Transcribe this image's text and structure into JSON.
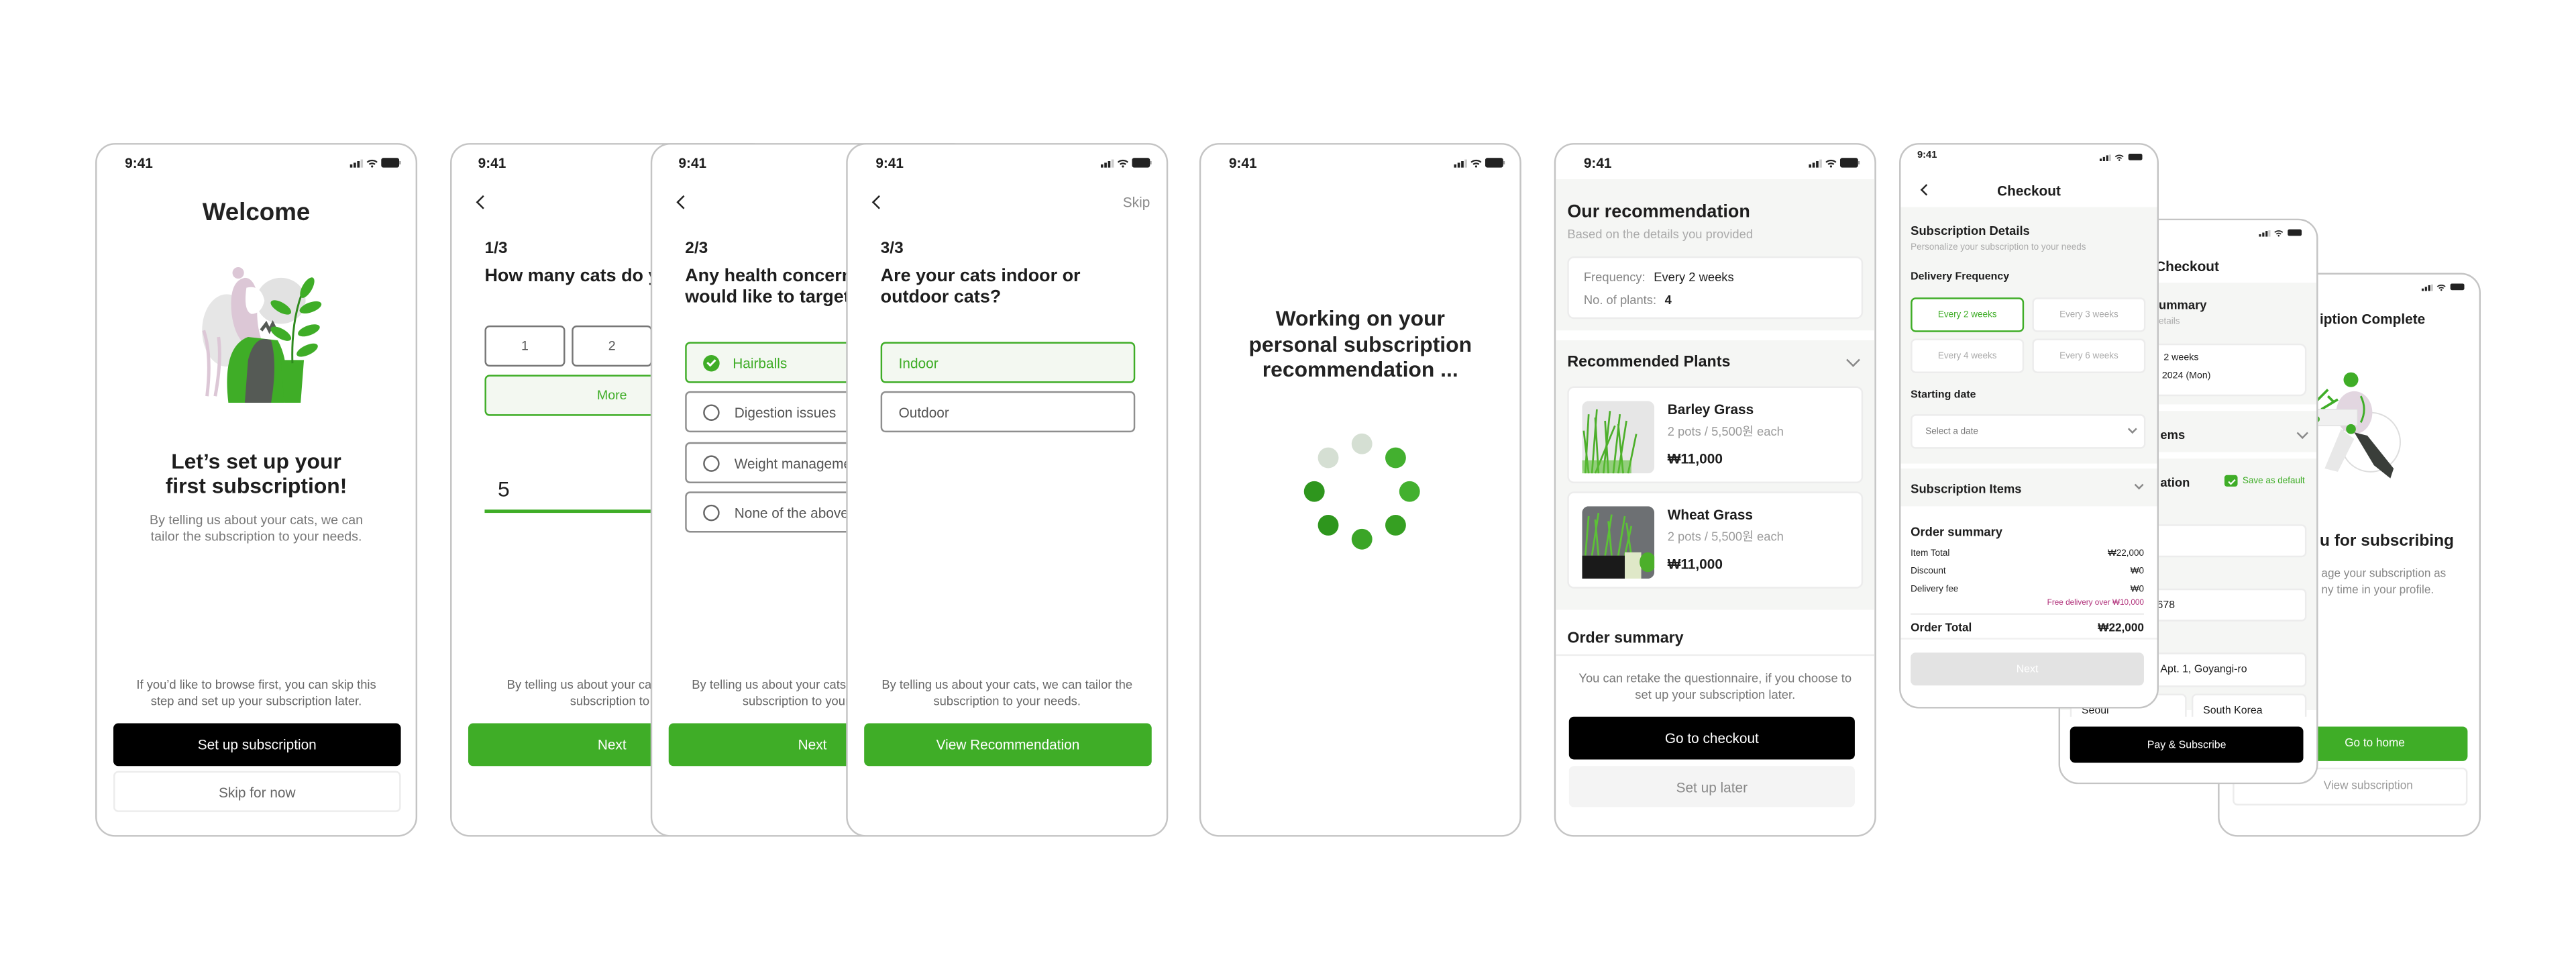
{
  "status_time": "9:41",
  "colors": {
    "accent": "#3fad27",
    "dark": "#000000",
    "promo": "#b0307a",
    "panel": "#f5f6f4"
  },
  "icons": [
    "signal-icon",
    "wifi-icon",
    "battery-icon",
    "chevron-left-icon",
    "chevron-down-icon",
    "check-circle-icon",
    "radio-icon",
    "checkbox-icon"
  ],
  "welcome": {
    "title": "Welcome",
    "headline_1": "Let’s set up your",
    "headline_2": "first subscription!",
    "body_1": "By telling us about your cats, we can",
    "body_2": "tailor the subscription to your needs.",
    "note_1": "If you’d like to browse first, you can skip this",
    "note_2": "step and set up your subscription later.",
    "primary_button": "Set up subscription",
    "secondary_button": "Skip for now"
  },
  "q1": {
    "step": "1/3",
    "question": "How many cats do y",
    "options": [
      "1",
      "2"
    ],
    "more": "More",
    "input_value": "5",
    "footer_1": "By telling us about your cats, w",
    "footer_2": "subscription to your",
    "next": "Next"
  },
  "q2": {
    "step": "2/3",
    "question_1": "Any health concern",
    "question_2": "would like to target’",
    "options": [
      {
        "label": "Hairballs",
        "selected": true
      },
      {
        "label": "Digestion issues",
        "selected": false
      },
      {
        "label": "Weight manageme",
        "selected": false
      },
      {
        "label": "None of the above",
        "selected": false
      }
    ],
    "footer_1": "By telling us about your cats,",
    "footer_2": "subscription to your",
    "next": "Next"
  },
  "q3": {
    "skip": "Skip",
    "step": "3/3",
    "question_1": "Are your cats indoor or",
    "question_2": "outdoor cats?",
    "options": [
      {
        "label": "Indoor",
        "selected": true
      },
      {
        "label": "Outdoor",
        "selected": false
      }
    ],
    "footer_1": "By telling us about your cats, we can tailor the",
    "footer_2": "subscription to your needs.",
    "button": "View Recommendation"
  },
  "loading": {
    "line_1": "Working on your",
    "line_2": "personal subscription",
    "line_3": "recommendation ..."
  },
  "recommendation": {
    "title": "Our recommendation",
    "subtitle": "Based on the details you provided",
    "frequency_label": "Frequency:",
    "frequency_value": "Every 2 weeks",
    "plants_label": "No. of plants:",
    "plants_value": "4",
    "plants_section": "Recommended Plants",
    "plants": [
      {
        "name": "Barley Grass",
        "detail": "2 pots / 5,500원 each",
        "price": "₩11,000"
      },
      {
        "name": "Wheat Grass",
        "detail": "2 pots / 5,500원 each",
        "price": "₩11,000"
      }
    ],
    "order_summary": "Order summary",
    "footer_1": "You can retake the questionnaire, if you choose to",
    "footer_2": "set up your subscription later.",
    "checkout_button": "Go to checkout",
    "later_button": "Set up later"
  },
  "checkout": {
    "title": "Checkout",
    "details_title": "Subscription Details",
    "details_sub": "Personalize your subscription to your needs",
    "frequency_label": "Delivery Frequency",
    "frequency_options": [
      {
        "label": "Every 2 weeks",
        "selected": true
      },
      {
        "label": "Every 3 weeks",
        "selected": false
      },
      {
        "label": "Every 4 weeks",
        "selected": false
      },
      {
        "label": "Every 6 weeks",
        "selected": false
      }
    ],
    "date_label": "Starting date",
    "date_placeholder": "Select a date",
    "items_title": "Subscription Items",
    "summary_title": "Order summary",
    "rows": [
      {
        "label": "Item Total",
        "value": "₩22,000"
      },
      {
        "label": "Discount",
        "value": "₩0"
      },
      {
        "label": "Delivery fee",
        "value": "₩0"
      }
    ],
    "free_delivery": "Free delivery over ₩10,000",
    "total_label": "Order Total",
    "total_value": "₩22,000",
    "next": "Next"
  },
  "checkout2": {
    "title": "Checkout",
    "summary_fragment": "ummary",
    "details_fragment": "etails",
    "frequency_fragment": "2 weeks",
    "date_fragment": "2024 (Mon)",
    "items_fragment": "ems",
    "info_fragment": "ation",
    "save_default": "Save as default",
    "save_default_checked": true,
    "phone_fragment": "678",
    "address": "Apt. 1, Goyangi-ro",
    "city": "Seoul",
    "country": "South Korea",
    "pay_button": "Pay & Subscribe"
  },
  "complete": {
    "title_fragment": "iption Complete",
    "headline_fragment": "u for subscribing",
    "body_1": "age your subscription as",
    "body_2": "ny time in your profile.",
    "home_button": "Go to home",
    "view_button": "View subscription"
  }
}
